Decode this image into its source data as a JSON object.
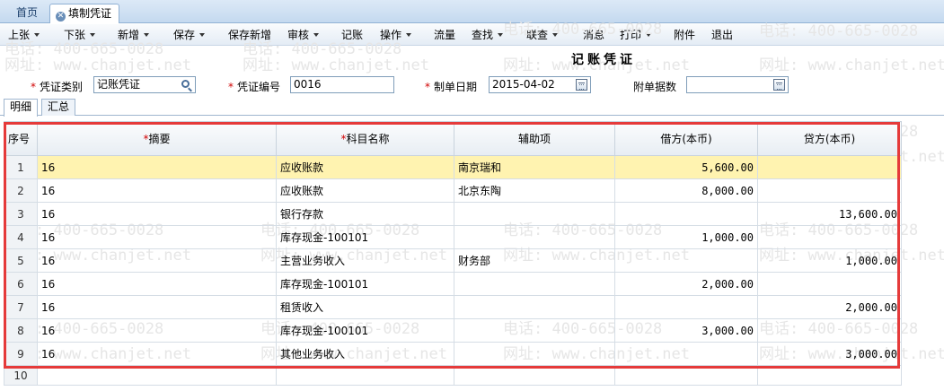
{
  "tabs": {
    "home": "首页",
    "active": "填制凭证"
  },
  "toolbar": {
    "items": [
      {
        "label": "上张",
        "dropdown": true
      },
      {
        "label": "下张",
        "dropdown": true
      },
      {
        "label": "新增",
        "dropdown": true
      },
      {
        "label": "保存",
        "dropdown": true
      },
      {
        "label": "保存新增",
        "dropdown": false
      },
      {
        "label": "审核",
        "dropdown": true
      },
      {
        "label": "记账",
        "dropdown": false
      },
      {
        "label": "操作",
        "dropdown": true
      },
      {
        "label": "流量",
        "dropdown": false
      },
      {
        "label": "查找",
        "dropdown": true
      },
      {
        "label": "联查",
        "dropdown": true
      },
      {
        "label": "消息",
        "dropdown": false
      },
      {
        "label": "打印",
        "dropdown": true
      },
      {
        "label": "附件",
        "dropdown": false
      },
      {
        "label": "退出",
        "dropdown": false
      }
    ]
  },
  "watermark": {
    "phone": "电话: 400-665-0028",
    "site": "网址: www.chanjet.net"
  },
  "form": {
    "title": "记账凭证",
    "voucher_type_label": "凭证类别",
    "voucher_type_value": "记账凭证",
    "voucher_no_label": "凭证编号",
    "voucher_no_value": "0016",
    "date_label": "制单日期",
    "date_value": "2015-04-02",
    "attachments_label": "附单据数",
    "attachments_value": ""
  },
  "subtabs": {
    "detail": "明细",
    "summary": "汇总"
  },
  "grid": {
    "headers": {
      "seq": "序号",
      "summary": "摘要",
      "account": "科目名称",
      "aux": "辅助项",
      "debit": "借方(本币)",
      "credit": "贷方(本币)"
    },
    "rows": [
      {
        "seq": "1",
        "summary": "16",
        "account": "应收账款",
        "aux": "南京瑞和",
        "debit": "5,600.00",
        "credit": ""
      },
      {
        "seq": "2",
        "summary": "16",
        "account": "应收账款",
        "aux": "北京东陶",
        "debit": "8,000.00",
        "credit": ""
      },
      {
        "seq": "3",
        "summary": "16",
        "account": "银行存款",
        "aux": "",
        "debit": "",
        "credit": "13,600.00"
      },
      {
        "seq": "4",
        "summary": "16",
        "account": "库存现金-100101",
        "aux": "",
        "debit": "1,000.00",
        "credit": ""
      },
      {
        "seq": "5",
        "summary": "16",
        "account": "主营业务收入",
        "aux": "财务部",
        "debit": "",
        "credit": "1,000.00"
      },
      {
        "seq": "6",
        "summary": "16",
        "account": "库存现金-100101",
        "aux": "",
        "debit": "2,000.00",
        "credit": ""
      },
      {
        "seq": "7",
        "summary": "16",
        "account": "租赁收入",
        "aux": "",
        "debit": "",
        "credit": "2,000.00"
      },
      {
        "seq": "8",
        "summary": "16",
        "account": "库存现金-100101",
        "aux": "",
        "debit": "3,000.00",
        "credit": ""
      },
      {
        "seq": "9",
        "summary": "16",
        "account": "其他业务收入",
        "aux": "",
        "debit": "",
        "credit": "3,000.00"
      },
      {
        "seq": "10",
        "summary": "",
        "account": "",
        "aux": "",
        "debit": "",
        "credit": ""
      }
    ]
  },
  "colors": {
    "highlight_row": "#fff3b0",
    "annotation_box": "#e53a3a",
    "required_mark": "#d00000"
  }
}
